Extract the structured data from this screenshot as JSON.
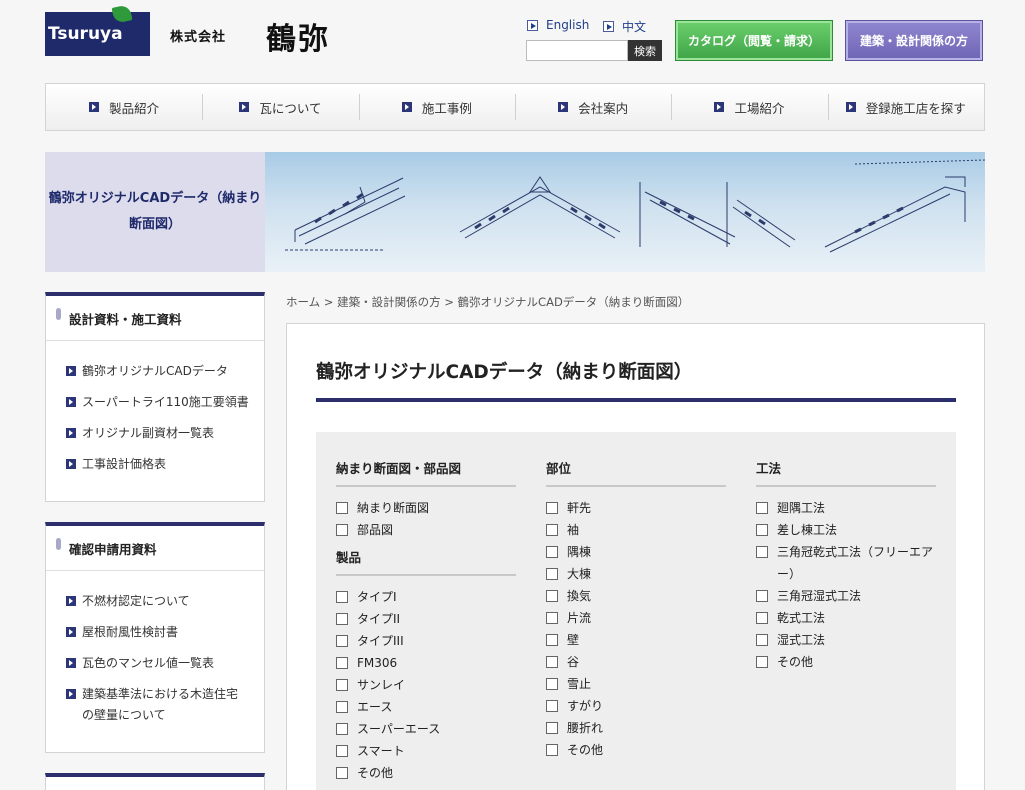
{
  "header": {
    "logo_text": "Tsuruya",
    "corp_prefix": "株式会社",
    "corp_name": "鶴弥",
    "lang_en": "English",
    "lang_zh": "中文",
    "search_placeholder": "",
    "search_button": "検索",
    "catalog_button": "カタログ（閲覧・請求）",
    "architect_button": "建築・設計関係の方"
  },
  "nav": {
    "items": [
      {
        "label": "製品紹介"
      },
      {
        "label": "瓦について"
      },
      {
        "label": "施工事例"
      },
      {
        "label": "会社案内"
      },
      {
        "label": "工場紹介"
      },
      {
        "label": "登録施工店を探す"
      }
    ]
  },
  "banner": {
    "title": "鶴弥オリジナルCADデータ（納まり断面図）"
  },
  "sidebar": {
    "section1": {
      "title": "設計資料・施工資料",
      "items": [
        {
          "label": "鶴弥オリジナルCADデータ"
        },
        {
          "label": "スーパートライ110施工要領書"
        },
        {
          "label": "オリジナル副資材一覧表"
        },
        {
          "label": "工事設計価格表"
        }
      ]
    },
    "section2": {
      "title": "確認申請用資料",
      "items": [
        {
          "label": "不燃材認定について"
        },
        {
          "label": "屋根耐風性検討書"
        },
        {
          "label": "瓦色のマンセル値一覧表"
        },
        {
          "label": "建築基準法における木造住宅の壁量について"
        }
      ]
    }
  },
  "breadcrumb": "ホーム > 建築・設計関係の方 > 鶴弥オリジナルCADデータ（納まり断面図）",
  "main": {
    "title": "鶴弥オリジナルCADデータ（納まり断面図）",
    "filters": {
      "col1": {
        "head1": "納まり断面図・部品図",
        "group1": [
          {
            "label": "納まり断面図"
          },
          {
            "label": "部品図"
          }
        ],
        "head2": "製品",
        "group2": [
          {
            "label": "タイプI"
          },
          {
            "label": "タイプII"
          },
          {
            "label": "タイプIII"
          },
          {
            "label": "FM306"
          },
          {
            "label": "サンレイ"
          },
          {
            "label": "エース"
          },
          {
            "label": "スーパーエース"
          },
          {
            "label": "スマート"
          },
          {
            "label": "その他"
          }
        ]
      },
      "col2": {
        "head": "部位",
        "items": [
          {
            "label": "軒先"
          },
          {
            "label": "袖"
          },
          {
            "label": "隅棟"
          },
          {
            "label": "大棟"
          },
          {
            "label": "換気"
          },
          {
            "label": "片流"
          },
          {
            "label": "壁"
          },
          {
            "label": "谷"
          },
          {
            "label": "雪止"
          },
          {
            "label": "すがり"
          },
          {
            "label": "腰折れ"
          },
          {
            "label": "その他"
          }
        ]
      },
      "col3": {
        "head": "工法",
        "items": [
          {
            "label": "廻隅工法"
          },
          {
            "label": "差し棟工法"
          },
          {
            "label": "三角冠乾式工法（フリーエアー）"
          },
          {
            "label": "三角冠湿式工法"
          },
          {
            "label": "乾式工法"
          },
          {
            "label": "湿式工法"
          },
          {
            "label": "その他"
          }
        ]
      }
    }
  }
}
